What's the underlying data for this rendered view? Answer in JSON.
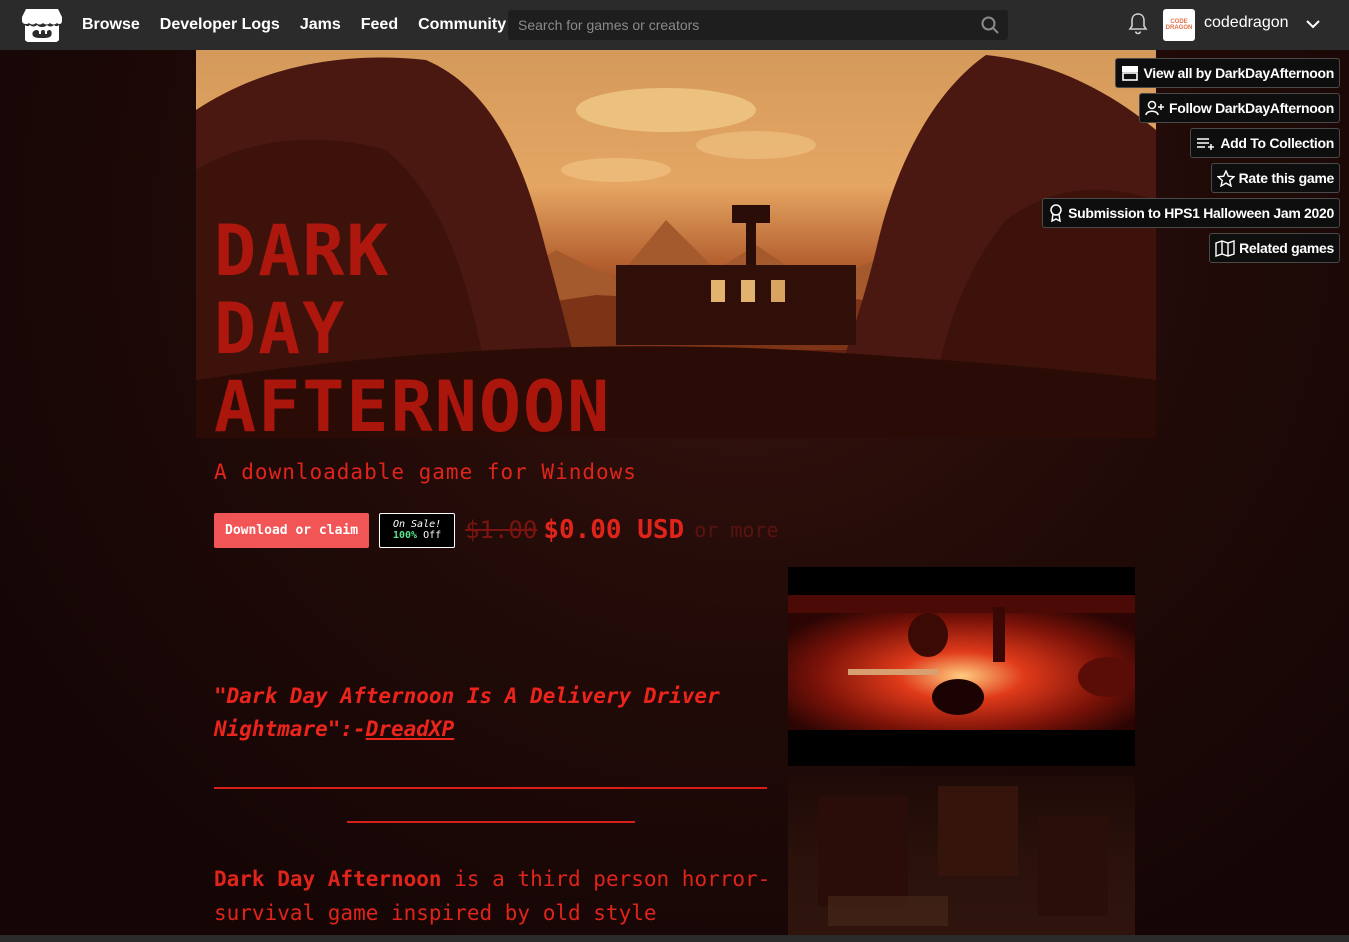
{
  "nav": {
    "items": [
      "Browse",
      "Developer Logs",
      "Jams",
      "Feed",
      "Community"
    ]
  },
  "search": {
    "placeholder": "Search for games or creators",
    "value": ""
  },
  "user": {
    "name": "codedragon",
    "avatar_text": "CODE DRAGON"
  },
  "banner": {
    "title_lines": [
      "DARK",
      "DAY",
      "AFTERNOON"
    ]
  },
  "actions": {
    "view_all": "View all by DarkDayAfternoon",
    "follow": "Follow DarkDayAfternoon",
    "add_collection": "Add To Collection",
    "rate": "Rate this game",
    "submission": "Submission to HPS1 Halloween Jam 2020",
    "related": "Related games"
  },
  "game": {
    "subtitle": "A downloadable game for Windows",
    "download_label": "Download or claim",
    "sale_line1": "On Sale!",
    "sale_pct": "100%",
    "sale_off": "Off",
    "old_price": "$1.00",
    "new_price": "$0.00 USD",
    "or_more": "or more"
  },
  "content": {
    "quote_text": "\"Dark Day Afternoon Is A Delivery Driver Nightmare\":-",
    "quote_link": "DreadXP",
    "desc_bold": "Dark Day Afternoon",
    "desc_rest": " is a third person horror-survival game inspired by old style"
  },
  "colors": {
    "accent_red": "#e0241b",
    "button_red": "#f25555",
    "header_bg": "#2b2b2b",
    "sale_green": "#59e08c"
  },
  "icons": {
    "logo": "itch-logo-icon",
    "search": "search-icon",
    "bell": "bell-icon",
    "chevron": "chevron-down-icon"
  }
}
